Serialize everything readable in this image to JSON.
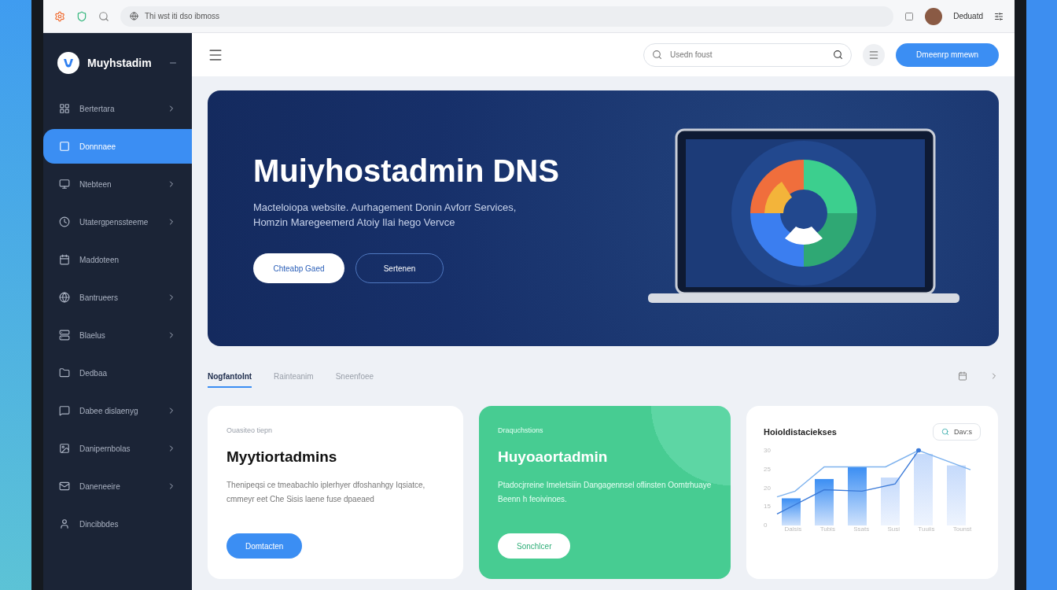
{
  "browser": {
    "address": "Thi wst iti dso ibmoss",
    "user": "Deduatd"
  },
  "sidebar": {
    "brand": "Muyhstadim",
    "items": [
      {
        "label": "Bertertara",
        "selected": false,
        "has_chevron": true
      },
      {
        "label": "Donnnaee",
        "selected": true,
        "has_chevron": false
      },
      {
        "label": "Ntebteen",
        "selected": false,
        "has_chevron": true
      },
      {
        "label": "Utatergpenssteeme",
        "selected": false,
        "has_chevron": true
      },
      {
        "label": "Maddoteen",
        "selected": false,
        "has_chevron": false
      },
      {
        "label": "Bantrueers",
        "selected": false,
        "has_chevron": true
      },
      {
        "label": "Blaelus",
        "selected": false,
        "has_chevron": true
      },
      {
        "label": "Dedbaa",
        "selected": false,
        "has_chevron": false
      },
      {
        "label": "Dabee dislaenyg",
        "selected": false,
        "has_chevron": true
      },
      {
        "label": "Danipernbolas",
        "selected": false,
        "has_chevron": true
      },
      {
        "label": "Daneneeire",
        "selected": false,
        "has_chevron": true
      },
      {
        "label": "Dincibbdes",
        "selected": false,
        "has_chevron": false
      }
    ]
  },
  "header": {
    "search": {
      "placeholder": "Usedn foust"
    },
    "button": "Dmeenrp mmewn"
  },
  "hero": {
    "title": "Muiyhostadmin DNS",
    "subtitle_lines": [
      "Macteloiopa website. Aurhagement Donin Avforr Services,",
      "Homzin Maregeemerd Atoiy Ilai hego Vervce"
    ],
    "primary_button": "Chteabp Gaed",
    "secondary_button": "Sertenen"
  },
  "tabs": [
    {
      "label": "Nogfantolnt",
      "selected": true
    },
    {
      "label": "Rainteanim",
      "selected": false
    },
    {
      "label": "Sneenfoee",
      "selected": false
    }
  ],
  "cards": [
    {
      "kind": "light",
      "eyebrow": "Ouasiteo tiepn",
      "title": "Myytiortadmins",
      "description": "Thenipeqsi ce tmeabachlo iplerhyer dfoshanhgy Iqsiatce, cmmeyr eet Che Sisis laene fuse dpaeaed",
      "button": "Domtacten"
    },
    {
      "kind": "green",
      "eyebrow": "Draquchstions",
      "title": "Huyoaortadmin",
      "description": "Ptadocjrreine Imeletsiiin Dangagennsel oflinsten Oomtrhuaye Beenn h feoivinoes.",
      "button": "Sonchlcer"
    }
  ],
  "chart_card": {
    "title": "Hoioldistaciekses",
    "button": "Dav:s",
    "y_labels": [
      "30",
      "25",
      "20",
      "15",
      "0"
    ],
    "x_labels": [
      "Dalsis",
      "Tubis",
      "Ssats",
      "Susi",
      "Tuuiis",
      "Tounst"
    ]
  }
}
